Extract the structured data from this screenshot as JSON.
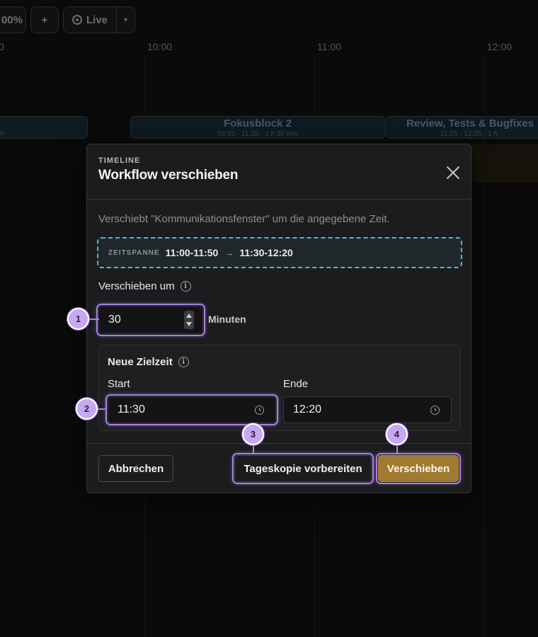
{
  "toolbar": {
    "zoom_label": "00%",
    "add_label": "+",
    "live_label": "Live"
  },
  "timeline": {
    "hours": [
      "0",
      "10:00",
      "11:00",
      "12:00"
    ],
    "blocks": [
      {
        "title": "",
        "sub": "in"
      },
      {
        "title": "Fokusblock 2",
        "sub": "09:55 - 11:25 · 1 h 30 min"
      },
      {
        "title": "Review, Tests & Bugfixes",
        "sub": "11:25 - 12:25 · 1 h"
      }
    ]
  },
  "dialog": {
    "eyebrow": "TIMELINE",
    "title": "Workflow verschieben",
    "description": "Verschiebt \"Kommunikationsfenster\" um die angegebene Zeit.",
    "range": {
      "label": "ZEITSPANNE",
      "from": "11:00-11:50",
      "arrow": "→",
      "to": "11:30-12:20"
    },
    "shift": {
      "label": "Verschieben um",
      "value": "30",
      "unit": "Minuten"
    },
    "target": {
      "title": "Neue Zielzeit",
      "start_label": "Start",
      "start_value": "11:30",
      "end_label": "Ende",
      "end_value": "12:20"
    },
    "buttons": {
      "cancel": "Abbrechen",
      "copy": "Tageskopie vorbereiten",
      "move": "Verschieben"
    }
  },
  "annotations": [
    "1",
    "2",
    "3",
    "4"
  ],
  "colors": {
    "accent_purple": "#a882e8",
    "badge_fill": "#c6a9f2",
    "primary_button": "#a17a32",
    "range_border": "#4fb6d6"
  }
}
